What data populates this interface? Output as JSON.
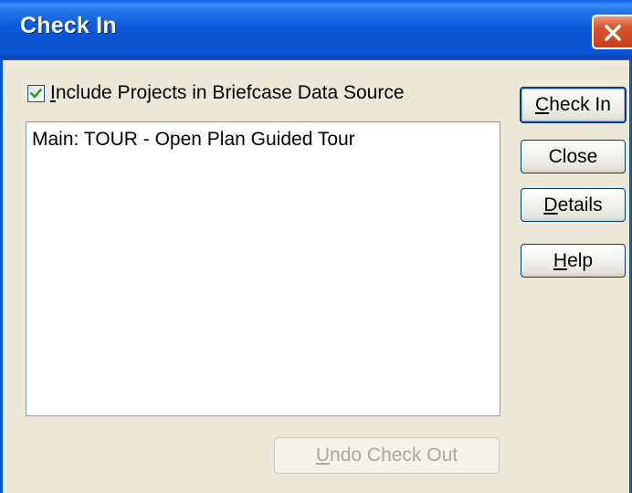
{
  "window": {
    "title": "Check In"
  },
  "options": {
    "include_projects": {
      "checked": true,
      "label_first": "I",
      "label_rest": "nclude Projects in Briefcase Data Source"
    }
  },
  "projects_list": {
    "items": [
      "Main: TOUR - Open Plan Guided Tour"
    ]
  },
  "buttons": {
    "check_in": {
      "mnemonic": "C",
      "rest": "heck In"
    },
    "close": {
      "label": "Close"
    },
    "details": {
      "mnemonic": "D",
      "rest": "etails"
    },
    "help": {
      "mnemonic": "H",
      "rest": "elp"
    },
    "undo_check_out": {
      "mnemonic": "U",
      "rest": "ndo Check Out",
      "enabled": false
    }
  },
  "colors": {
    "titlebar": "#0a53d0",
    "face": "#ece9d8",
    "close_button": "#d8532d",
    "disabled_text": "#aca899"
  }
}
